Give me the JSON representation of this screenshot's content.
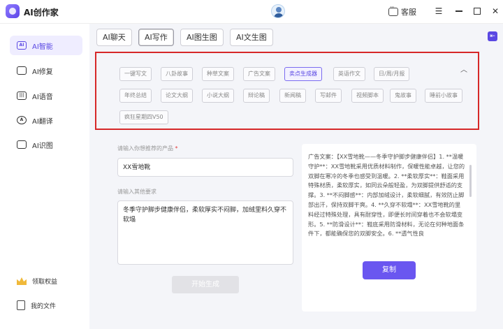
{
  "app": {
    "title": "AI创作家"
  },
  "titlebar": {
    "service_label": "客服"
  },
  "sidebar": {
    "items": [
      {
        "label": "AI智能",
        "icon": "ai-chip-icon"
      },
      {
        "label": "AI修复",
        "icon": "image-repair-icon"
      },
      {
        "label": "AI语音",
        "icon": "audio-icon"
      },
      {
        "label": "AI翻译",
        "icon": "translate-icon"
      },
      {
        "label": "AI识图",
        "icon": "image-recognize-icon"
      }
    ],
    "bottom": [
      {
        "label": "领取权益",
        "icon": "crown-icon"
      },
      {
        "label": "我的文件",
        "icon": "file-icon"
      }
    ]
  },
  "tabs": [
    {
      "label": "AI聊天"
    },
    {
      "label": "AI写作"
    },
    {
      "label": "AI图生图"
    },
    {
      "label": "AI文生图"
    }
  ],
  "types": [
    "一键写文",
    "八卦故事",
    "种草文案",
    "广告文案",
    "卖点生成器",
    "英语作文",
    "日/周/月报",
    "年终总结",
    "论文大纲",
    "小说大纲",
    "辩论稿",
    "新闻稿",
    "写邮件",
    "视频脚本",
    "鬼故事",
    "睡前小故事",
    "疯狂星期四V50"
  ],
  "active_type": "卖点生成器",
  "form": {
    "product_label": "请输入你想推荐的产品",
    "product_required": "*",
    "product_value": "XX雪地靴",
    "other_label": "请输入其他要求",
    "other_value": "冬季守护脚步健康伴侣，柔软厚实不闷脚，加绒里料久穿不软塌",
    "generate_label": "开始生成"
  },
  "result": {
    "text": "广告文案：【XX雪地靴——冬季守护脚步健康伴侣】1. **温暖守护**：XX雪地靴采用优质材料制作，保暖性能卓越，让您的双脚在寒冷的冬季也感受到温暖。2. **柔软厚实**：鞋面采用特殊材质，柔软厚实，如同云朵般轻盈，为双脚提供舒适的支撑。3. **不闷脚感**：内部加绒设计，柔软细腻，有效防止脚部出汗，保持双脚干爽。4. **久穿不软塌**：XX雪地靴的里料经过特殊处理，具有耐穿性，即便长时间穿着也不会软塌变形。5. **防滑设计**：鞋底采用防滑材料，无论在何种地面条件下，都能确保您的双脚安全。6. **透气性良",
    "copy_label": "复制"
  },
  "colors": {
    "accent": "#6a56f0",
    "highlight_border": "#d62828"
  }
}
